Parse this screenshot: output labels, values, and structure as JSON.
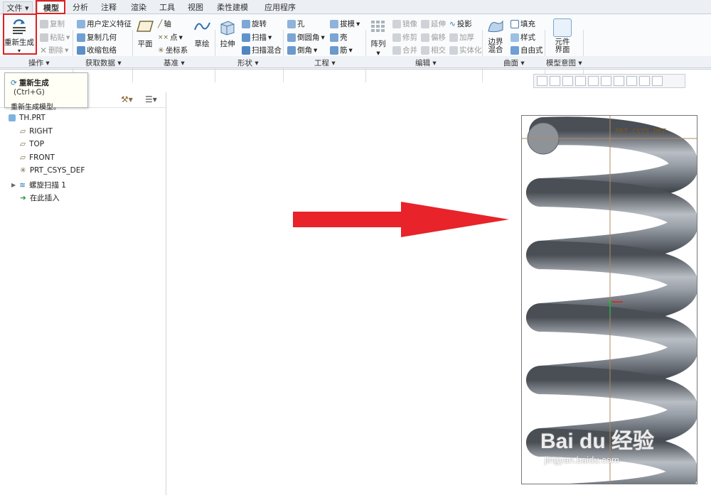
{
  "tabs": [
    "文件",
    "模型",
    "分析",
    "注释",
    "渲染",
    "工具",
    "视图",
    "柔性建模",
    "应用程序"
  ],
  "ribbon": {
    "operations": {
      "regen": "重新生成",
      "copy": "复制",
      "paste": "粘贴",
      "delete": "删除",
      "group": "操作"
    },
    "get_data": {
      "udf": "用户定义特征",
      "copy_geom": "复制几何",
      "shrinkwrap": "收缩包络",
      "group": "获取数据"
    },
    "datum": {
      "plane": "平面",
      "axis": "轴",
      "point": "点",
      "csys": "坐标系",
      "sketch": "草绘",
      "group": "基准"
    },
    "shapes": {
      "extrude": "拉伸",
      "revolve": "旋转",
      "sweep": "扫描",
      "swept_blend": "扫描混合",
      "group": "形状"
    },
    "engineering": {
      "hole": "孔",
      "round": "倒圆角",
      "chamfer": "倒角",
      "draft": "拔模",
      "shell": "壳",
      "rib": "筋",
      "group": "工程"
    },
    "editing": {
      "pattern": "阵列",
      "mirror": "镜像",
      "trim": "修剪",
      "merge": "合并",
      "extend": "延伸",
      "offset": "偏移",
      "intersect": "相交",
      "project": "投影",
      "thicken": "加厚",
      "solidify": "实体化",
      "group": "编辑"
    },
    "surfaces": {
      "boundary_blend_1": "边界",
      "boundary_blend_2": "混合",
      "fill": "填充",
      "style": "样式",
      "freestyle": "自由式",
      "group": "曲面"
    },
    "model_intent": {
      "component_1": "元件",
      "component_2": "界面",
      "group": "模型意图"
    }
  },
  "tooltip": {
    "title": "重新生成",
    "shortcut": "(Ctrl+G)",
    "description": "重新生成模型。"
  },
  "tree": {
    "items": [
      "TH.PRT",
      "RIGHT",
      "TOP",
      "FRONT",
      "PRT_CSYS_DEF",
      "螺旋扫描 1",
      "在此插入"
    ]
  },
  "viewport": {
    "csys_label": "PRT_CSYS_DEF"
  },
  "watermark": {
    "brand": "Bai du 经验",
    "url": "jingyan.baidu.com"
  },
  "colors": {
    "highlight": "#e02020",
    "arrow": "#e8232a",
    "spring": "#5c6168"
  }
}
